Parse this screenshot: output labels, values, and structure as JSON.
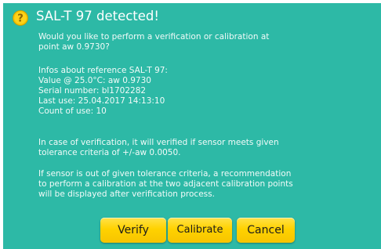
{
  "dialog": {
    "title": "SAL-T 97 detected!",
    "title_icon": "help-question-icon",
    "question": [
      "Would you like to perform a verification or calibration at",
      "point aw 0.9730?"
    ],
    "infos": [
      "Infos about reference SAL-T 97:",
      "Value @ 25.0°C: aw 0.9730",
      "Serial number: bl1702282",
      "Last use: 25.04.2017 14:13:10",
      "Count of use: 10"
    ],
    "verification_note": [
      "In case of verification, it will verified if sensor meets given",
      "tolerance criteria of +/-aw 0.0050."
    ],
    "recommendation_note": [
      "If sensor is out of given tolerance criteria, a recommendation",
      "to perform a calibration at the two adjacent calibration points",
      "will be displayed after verification process."
    ]
  },
  "buttons": {
    "verify_label": "Verify",
    "calibrate_label": "Calibrate",
    "cancel_label": "Cancel"
  },
  "colors": {
    "dialog_background": "#2db9a6",
    "button_yellow": "#ffd200",
    "icon_yellow": "#f5c400"
  }
}
